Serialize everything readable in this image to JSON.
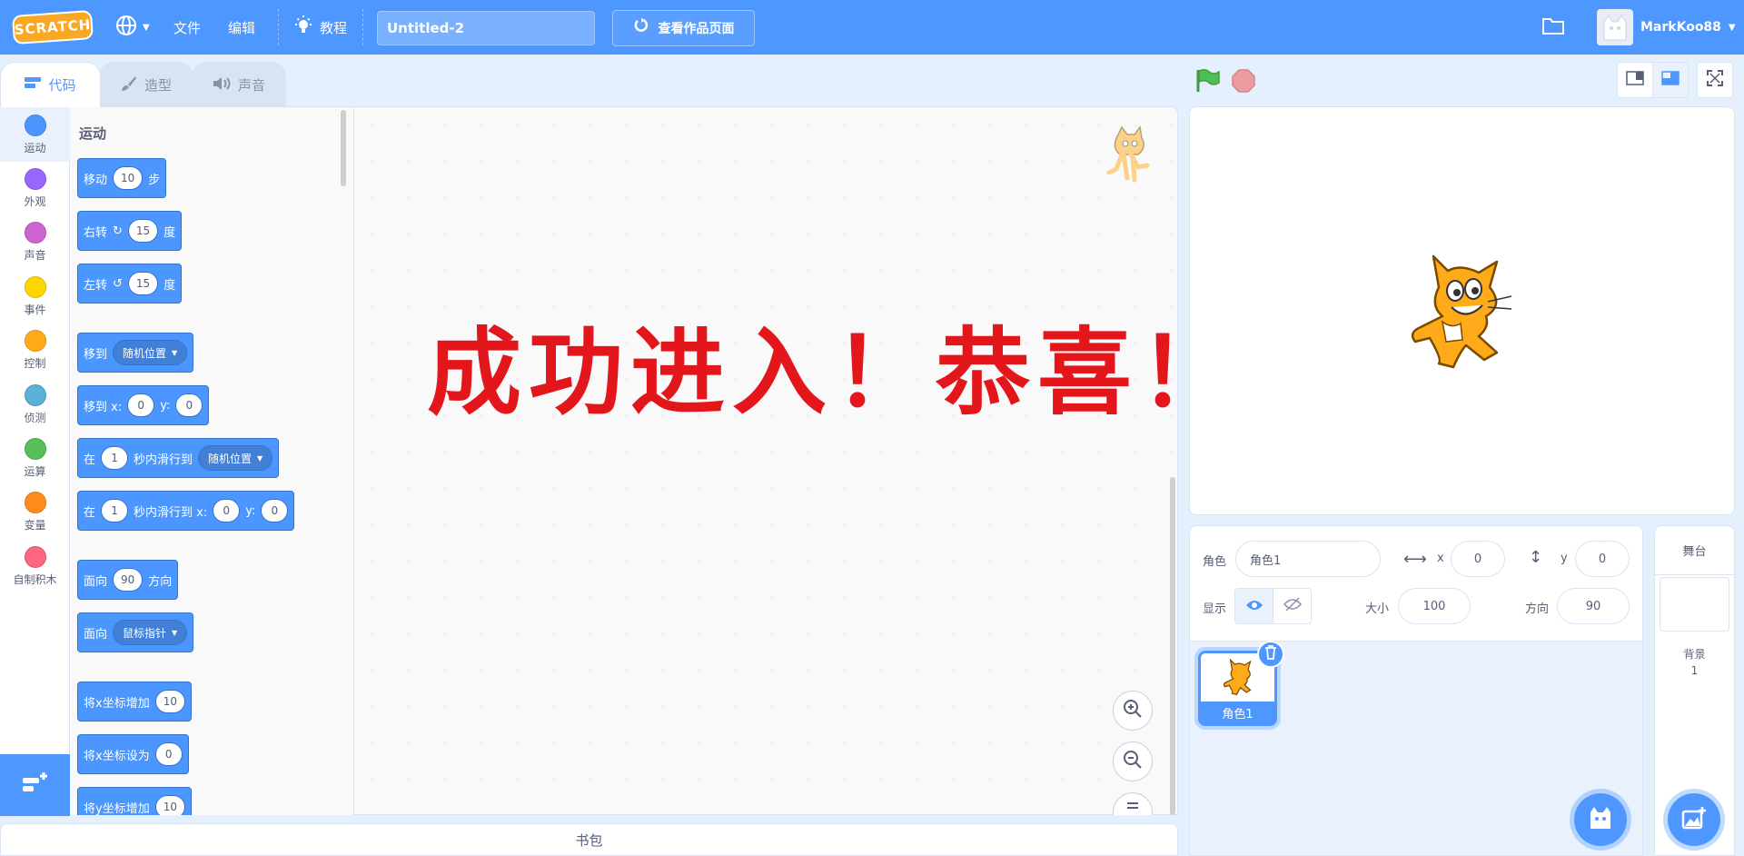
{
  "menubar": {
    "logo": "SCRATCH",
    "file": "文件",
    "edit": "编辑",
    "tutorials": "教程",
    "project_title": "Untitled-2",
    "see_project_page": "查看作品页面",
    "username": "MarkKoo88"
  },
  "tabs": [
    {
      "label": "代码"
    },
    {
      "label": "造型"
    },
    {
      "label": "声音"
    }
  ],
  "categories": [
    {
      "label": "运动",
      "color": "#4c97ff"
    },
    {
      "label": "外观",
      "color": "#9966ff"
    },
    {
      "label": "声音",
      "color": "#cf63cf"
    },
    {
      "label": "事件",
      "color": "#ffd500"
    },
    {
      "label": "控制",
      "color": "#ffab19"
    },
    {
      "label": "侦测",
      "color": "#5cb1d6"
    },
    {
      "label": "运算",
      "color": "#59c059"
    },
    {
      "label": "变量",
      "color": "#ff8c1a"
    },
    {
      "label": "自制积木",
      "color": "#ff6680"
    }
  ],
  "palette": {
    "section_title": "运动",
    "blocks": {
      "move": {
        "a": "移动",
        "v": "10",
        "b": "步"
      },
      "turn_right": {
        "a": "右转",
        "v": "15",
        "b": "度"
      },
      "turn_left": {
        "a": "左转",
        "v": "15",
        "b": "度"
      },
      "goto": {
        "a": "移到",
        "drop": "随机位置"
      },
      "goto_xy": {
        "a": "移到 x:",
        "x": "0",
        "b": "y:",
        "y": "0"
      },
      "glide": {
        "a": "在",
        "v": "1",
        "b": "秒内滑行到",
        "drop": "随机位置"
      },
      "glide_xy": {
        "a": "在",
        "v": "1",
        "b": "秒内滑行到 x:",
        "x": "0",
        "c": "y:",
        "y": "0"
      },
      "point_dir": {
        "a": "面向",
        "v": "90",
        "b": "方向"
      },
      "point_towards": {
        "a": "面向",
        "drop": "鼠标指针"
      },
      "change_x": {
        "a": "将x坐标增加",
        "v": "10"
      },
      "set_x": {
        "a": "将x坐标设为",
        "v": "0"
      },
      "change_y": {
        "a": "将y坐标增加",
        "v": "10"
      }
    }
  },
  "overlay_text": "成功进入！恭喜！",
  "backpack_label": "书包",
  "sprite_info": {
    "sprite_label": "角色",
    "sprite_name": "角色1",
    "x_label": "x",
    "x_value": "0",
    "y_label": "y",
    "y_value": "0",
    "show_label": "显示",
    "size_label": "大小",
    "size_value": "100",
    "direction_label": "方向",
    "direction_value": "90"
  },
  "sprite_list": [
    {
      "name": "角色1"
    }
  ],
  "stage_pane": {
    "header": "舞台",
    "backdrops_label": "背景",
    "backdrops_count": "1"
  }
}
